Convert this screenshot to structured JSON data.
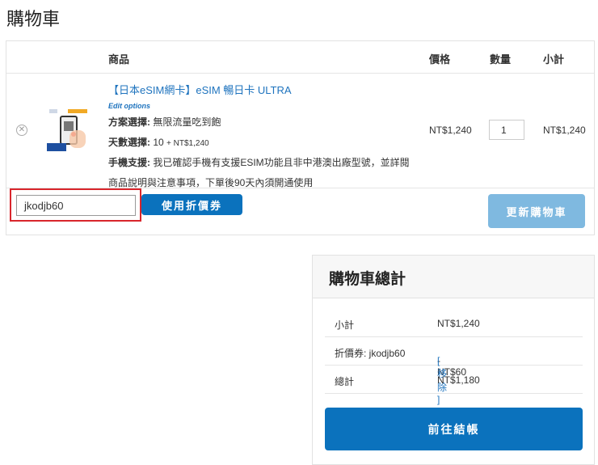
{
  "page_title": "購物車",
  "table": {
    "headers": {
      "product": "商品",
      "price": "價格",
      "quantity": "數量",
      "subtotal": "小計"
    }
  },
  "item": {
    "name": "【日本eSIM網卡】eSIM 暢日卡 ULTRA",
    "edit_options": "Edit options",
    "options": [
      {
        "label": "方案選擇:",
        "value": "無限流量吃到飽"
      },
      {
        "label": "天數選擇:",
        "value": "10",
        "extra": "+ NT$1,240"
      },
      {
        "label": "手機支援:",
        "value": "我已確認手機有支援ESIM功能且非中港澳出廠型號，並詳閱",
        "value2": "商品說明與注意事項，下單後90天內須開通使用"
      }
    ],
    "price": "NT$1,240",
    "quantity": "1",
    "subtotal": "NT$1,240"
  },
  "coupon": {
    "value": "jkodjb60",
    "apply_label": "使用折價券"
  },
  "update_label": "更新購物車",
  "totals": {
    "title": "購物車總計",
    "subtotal_label": "小計",
    "subtotal_value": "NT$1,240",
    "coupon_label": "折價券: jkodjb60",
    "coupon_value": "-NT$60",
    "remove_label": "[ 移除 ]",
    "total_label": "總計",
    "total_value": "NT$1,180",
    "checkout_label": "前往結帳"
  },
  "colors": {
    "accent": "#0b72bd",
    "highlight": "#d9262c",
    "disabled": "#7fb9e0"
  }
}
